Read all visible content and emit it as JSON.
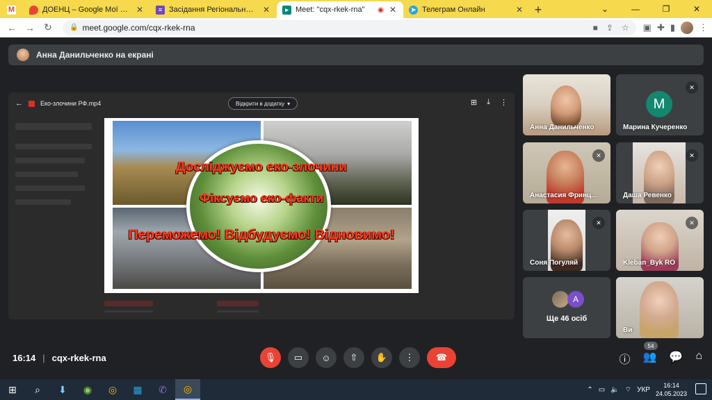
{
  "browser": {
    "tabs": [
      {
        "title": "ДОЕНЦ – Google Мої карти",
        "icon": "maps-icon",
        "color": "#ea4335"
      },
      {
        "title": "Засідання Регіонального осере...",
        "icon": "forms-icon",
        "color": "#7248b9"
      },
      {
        "title": "Meet: \"cqx-rkek-rna\"",
        "icon": "meet-icon",
        "color": "#00897b",
        "active": true,
        "recording": true
      },
      {
        "title": "Телеграм Онлайн",
        "icon": "telegram-icon",
        "color": "#2aa3e0"
      }
    ],
    "gmail_icon_color": "#ea4335",
    "url": "meet.google.com/cqx-rkek-rna"
  },
  "meet": {
    "presenting_banner": "Анна Данильченко на екрані",
    "presentation": {
      "file_name": "Еко-злочини РФ.mp4",
      "open_with": "Відкрити в додатку",
      "slide_lines": [
        "Досліджуємо еко-злочини",
        "Фіксуємо еко-факти",
        "Переможемо! Відбудуємо! Відновимо!"
      ]
    },
    "participants": [
      {
        "name": "Анна Данильченко",
        "muted": false
      },
      {
        "name": "Марина Кучеренко",
        "muted": true,
        "initial": "M",
        "avatar_color": "#13876f"
      },
      {
        "name": "Анастасия Фринц...",
        "muted": true
      },
      {
        "name": "Даша Ревенко",
        "muted": true
      },
      {
        "name": "Соня Погуляй",
        "muted": true
      },
      {
        "name": "Kleban_Byk RO",
        "muted": true
      },
      {
        "more_label": "Ще 46 осіб",
        "more_initial": "A"
      },
      {
        "name": "Ви",
        "muted": false
      }
    ],
    "meeting_time": "16:14",
    "meeting_code": "cqx-rkek-rna",
    "participant_count": "54"
  },
  "taskbar": {
    "language": "УКР",
    "time": "16:14",
    "date": "24.05.2023"
  }
}
